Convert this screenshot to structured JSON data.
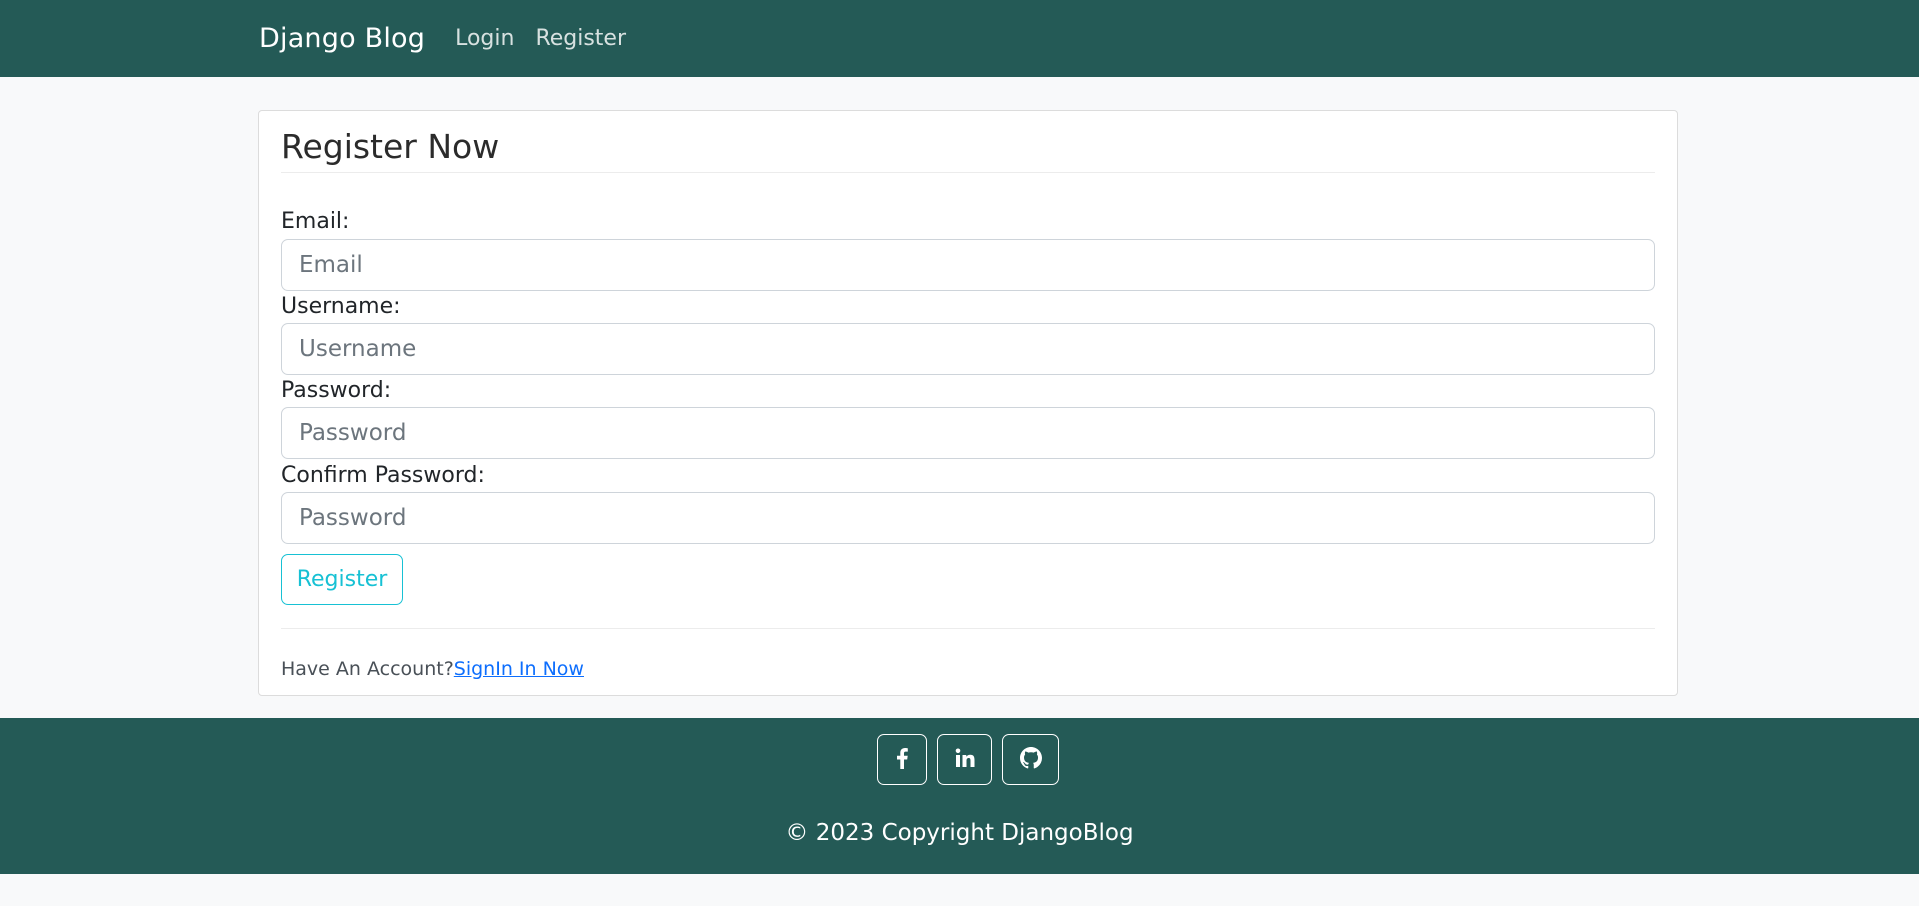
{
  "navbar": {
    "brand": "Django Blog",
    "links": [
      {
        "label": "Login"
      },
      {
        "label": "Register"
      }
    ]
  },
  "form": {
    "title": "Register Now",
    "fields": [
      {
        "label": "Email:",
        "placeholder": "Email",
        "value": ""
      },
      {
        "label": "Username:",
        "placeholder": "Username",
        "value": ""
      },
      {
        "label": "Password:",
        "placeholder": "Password",
        "value": ""
      },
      {
        "label": "Confirm Password:",
        "placeholder": "Password",
        "value": ""
      }
    ],
    "submit_label": "Register",
    "account_prompt": "Have An Account?",
    "signin_label": "SignIn In Now"
  },
  "footer": {
    "social": [
      {
        "icon": "facebook-icon"
      },
      {
        "icon": "linkedin-icon"
      },
      {
        "icon": "github-icon"
      }
    ],
    "copyright": "© 2023 Copyright DjangoBlog"
  },
  "colors": {
    "navbar_bg": "#245a56",
    "footer_bg": "#245a56",
    "register_button": "#17c1d4",
    "link": "#0d6efd",
    "page_bg": "#f8f9fa"
  }
}
